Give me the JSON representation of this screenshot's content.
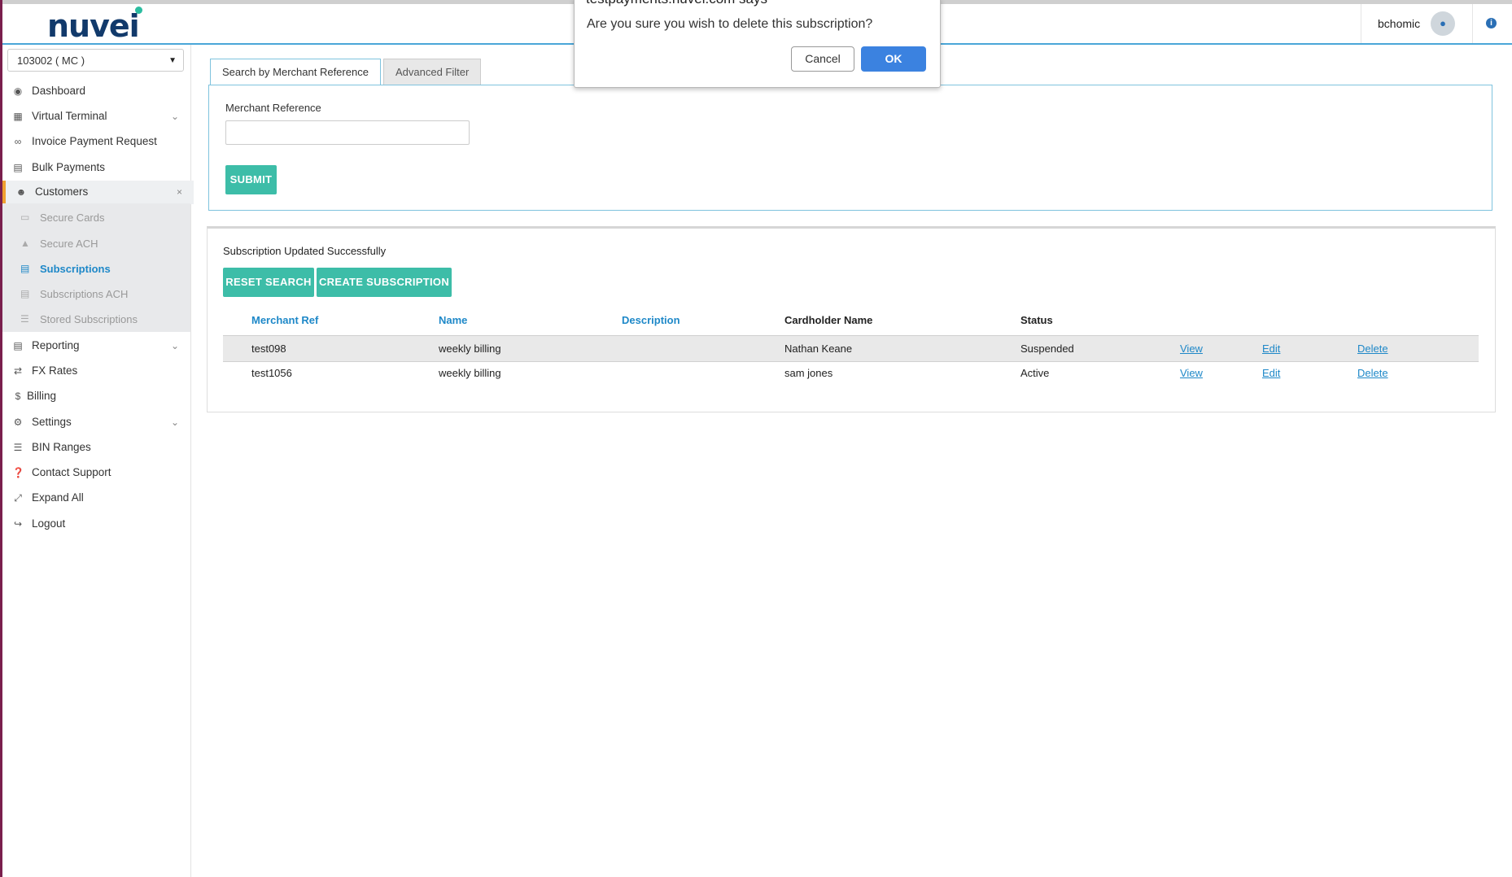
{
  "brand": {
    "logo_text": "nuvei"
  },
  "header": {
    "user_name": "bchomic"
  },
  "sidebar": {
    "merchant_select_value": "103002 ( MC )",
    "items": [
      {
        "label": "Dashboard",
        "icon": "dashboard-icon"
      },
      {
        "label": "Virtual Terminal",
        "icon": "calculator-icon"
      },
      {
        "label": "Invoice Payment Request",
        "icon": "link-icon"
      },
      {
        "label": "Bulk Payments",
        "icon": "file-icon"
      },
      {
        "label": "Customers",
        "icon": "users-icon"
      },
      {
        "label": "Reporting",
        "icon": "report-icon"
      },
      {
        "label": "FX Rates",
        "icon": "exchange-icon"
      },
      {
        "label": "Billing",
        "icon": "dollar-icon"
      },
      {
        "label": "Settings",
        "icon": "cogs-icon"
      },
      {
        "label": "BIN Ranges",
        "icon": "list-icon"
      },
      {
        "label": "Contact Support",
        "icon": "question-icon"
      },
      {
        "label": "Expand All",
        "icon": "expand-icon"
      },
      {
        "label": "Logout",
        "icon": "logout-icon"
      }
    ],
    "customers_sub": [
      {
        "label": "Secure Cards"
      },
      {
        "label": "Secure ACH"
      },
      {
        "label": "Subscriptions"
      },
      {
        "label": "Subscriptions ACH"
      },
      {
        "label": "Stored Subscriptions"
      }
    ]
  },
  "tabs": {
    "search_by_ref": "Search by Merchant Reference",
    "advanced_filter": "Advanced Filter"
  },
  "search": {
    "field_label": "Merchant Reference",
    "field_value": "",
    "submit_label": "SUBMIT"
  },
  "results": {
    "status_message": "Subscription Updated Successfully",
    "reset_label": "RESET SEARCH",
    "create_label": "CREATE SUBSCRIPTION",
    "columns": [
      "Merchant Ref",
      "Name",
      "Description",
      "Cardholder Name",
      "Status"
    ],
    "rows": [
      {
        "ref": "test098",
        "name": "weekly billing",
        "description": "",
        "cardholder": "Nathan Keane",
        "status": "Suspended",
        "view": "View",
        "edit": "Edit",
        "delete": "Delete"
      },
      {
        "ref": "test1056",
        "name": "weekly billing",
        "description": "",
        "cardholder": "sam jones",
        "status": "Active",
        "view": "View",
        "edit": "Edit",
        "delete": "Delete"
      }
    ]
  },
  "dialog": {
    "title": "testpayments.nuvei.com says",
    "message": "Are you sure you wish to delete this subscription?",
    "cancel_label": "Cancel",
    "ok_label": "OK"
  },
  "colors": {
    "brand_navy": "#123a6b",
    "accent_teal": "#3dbda8",
    "link_blue": "#1e88c8",
    "ok_blue": "#3b82e0",
    "active_marker": "#f0a030"
  }
}
